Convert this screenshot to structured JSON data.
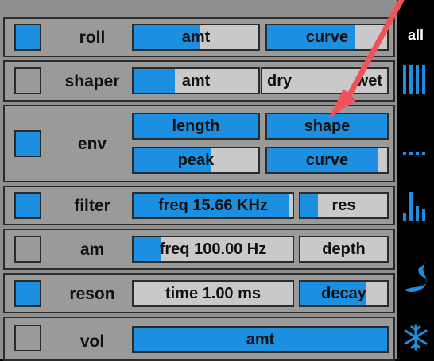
{
  "rows": [
    {
      "label": "roll",
      "toggle_on": true,
      "controls": [
        {
          "text": "amt",
          "fill": 0.53
        },
        {
          "text": "curve",
          "fill": 0.73
        }
      ]
    },
    {
      "label": "shaper",
      "toggle_on": false,
      "controls": [
        {
          "text": "amt",
          "fill": 0.33
        },
        {
          "left": "dry",
          "right": "wet",
          "fill": 0.45
        }
      ]
    },
    {
      "label": "env",
      "toggle_on": true,
      "controls": [
        {
          "text": "length",
          "fill": 1.0
        },
        {
          "text": "shape",
          "fill": 1.0
        },
        {
          "text": "peak",
          "fill": 0.62
        },
        {
          "text": "curve",
          "fill": 0.92
        }
      ]
    },
    {
      "label": "filter",
      "toggle_on": true,
      "controls": [
        {
          "text": "freq 15.66 KHz",
          "fill": 0.98
        },
        {
          "text": "res",
          "fill": 0.2
        }
      ]
    },
    {
      "label": "am",
      "toggle_on": false,
      "controls": [
        {
          "text": "freq 100.00 Hz",
          "fill": 0.17
        },
        {
          "text": "depth",
          "fill": 0.0
        }
      ]
    },
    {
      "label": "reson",
      "toggle_on": true,
      "controls": [
        {
          "text": "time 1.00 ms",
          "fill": 0.0
        },
        {
          "text": "decay",
          "fill": 0.75
        }
      ]
    },
    {
      "label": "vol",
      "toggle_on": false,
      "controls": [
        {
          "text": "amt",
          "fill": 1.0
        }
      ]
    }
  ],
  "sidebar": {
    "all_label": "all",
    "icons": [
      "bars-icon",
      "dots-icon",
      "levels-icon",
      "wave-icon",
      "snowflake-icon"
    ]
  },
  "colors": {
    "accent": "#1c8fe0",
    "annotation_arrow": "#f0525a"
  }
}
